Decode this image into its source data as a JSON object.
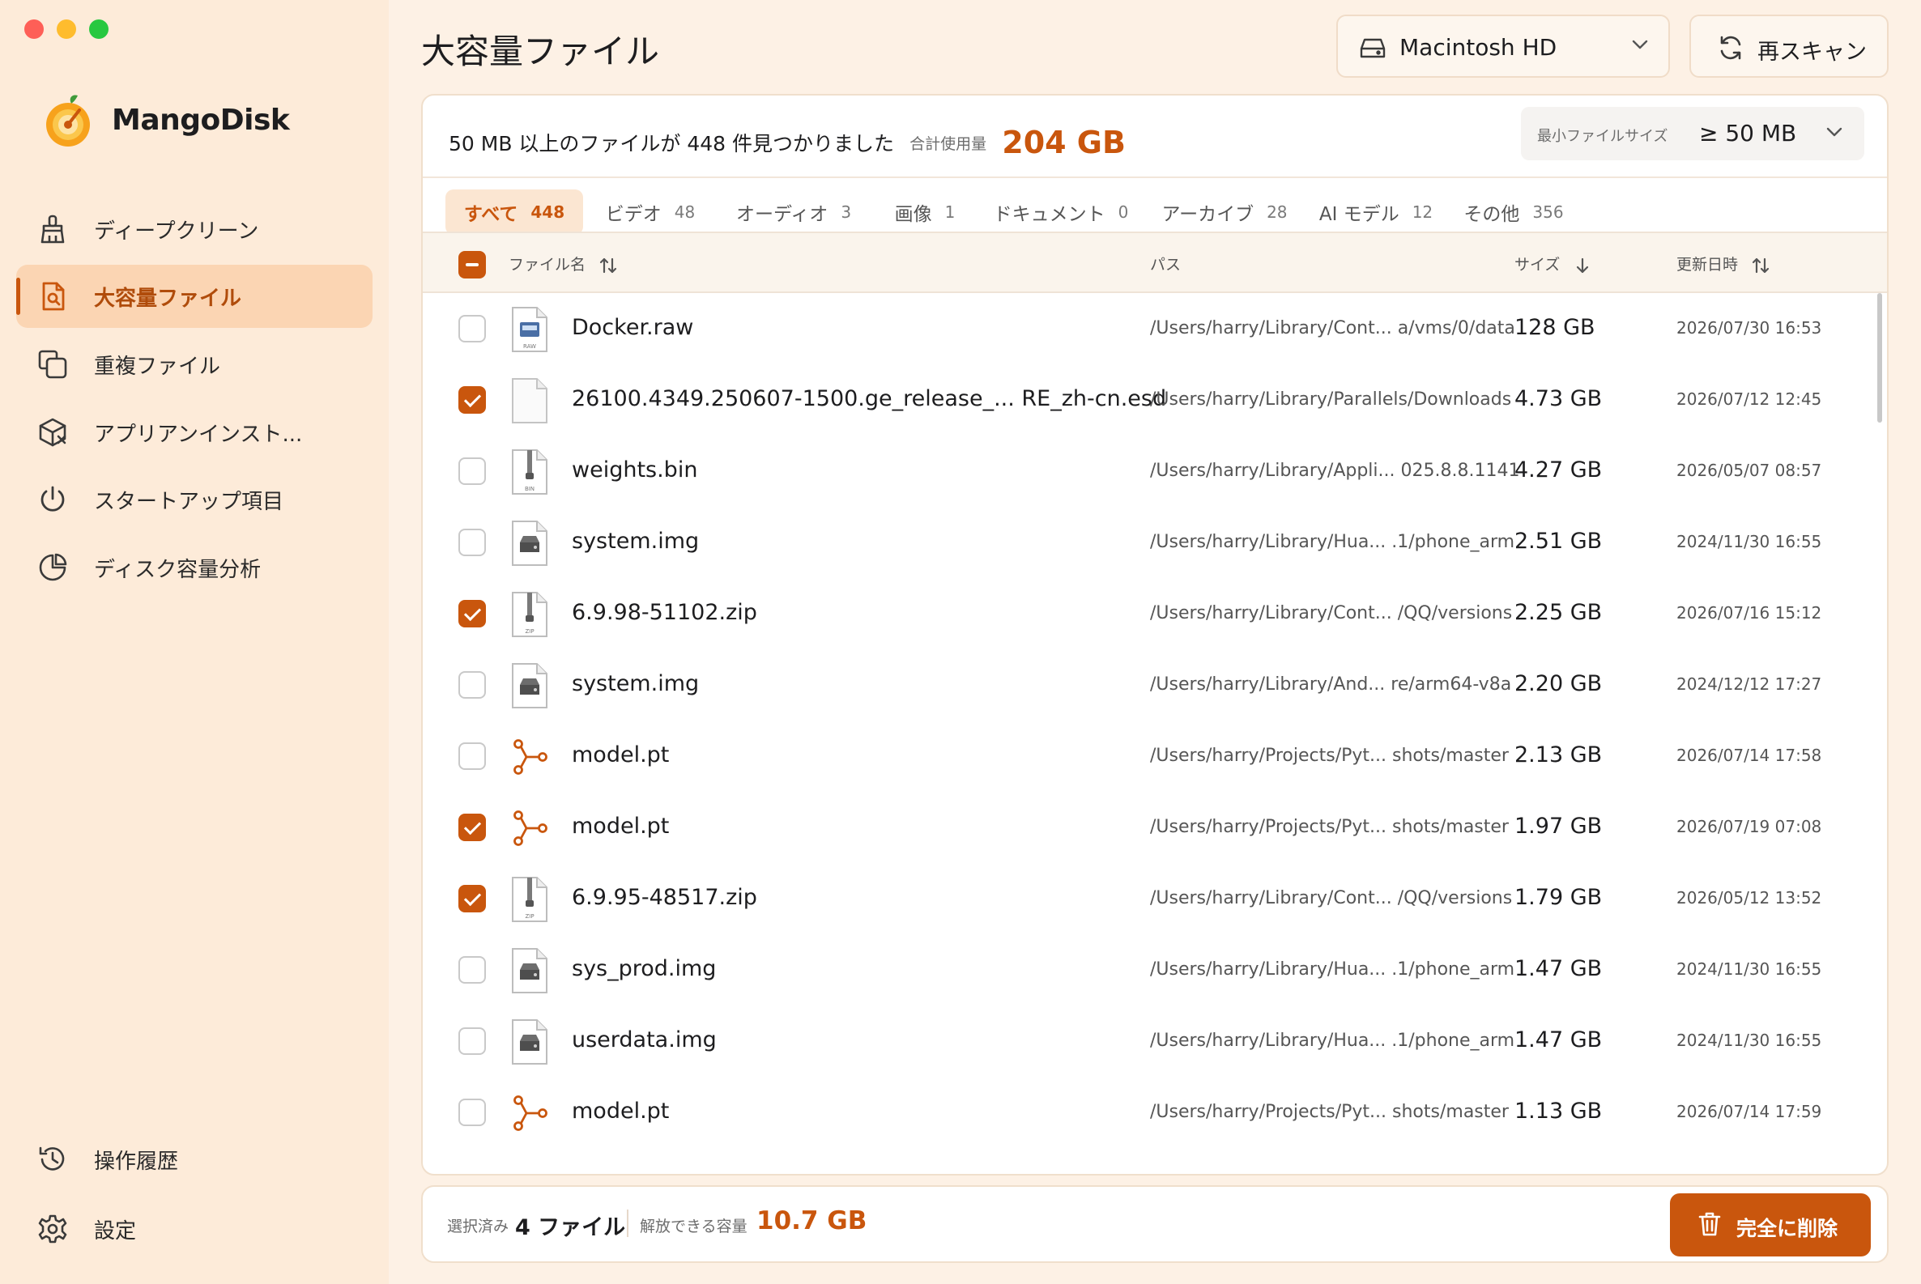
{
  "app": {
    "name": "MangoDisk"
  },
  "sidebar": {
    "items": [
      {
        "label": "ディープクリーン",
        "icon": "broom-icon"
      },
      {
        "label": "大容量ファイル",
        "icon": "document-search-icon",
        "active": true
      },
      {
        "label": "重複ファイル",
        "icon": "duplicate-icon"
      },
      {
        "label": "アプリアンインスト...",
        "icon": "package-remove-icon"
      },
      {
        "label": "スタートアップ項目",
        "icon": "power-icon"
      },
      {
        "label": "ディスク容量分析",
        "icon": "pie-chart-icon"
      }
    ],
    "bottom": [
      {
        "label": "操作履歴",
        "icon": "history-icon"
      },
      {
        "label": "設定",
        "icon": "gear-icon"
      }
    ]
  },
  "header": {
    "title": "大容量ファイル",
    "disk": "Macintosh HD",
    "rescan": "再スキャン"
  },
  "summary": {
    "text": "50 MB 以上のファイルが 448 件見つかりました",
    "total_label": "合計使用量",
    "total_value": "204 GB",
    "min_size_label": "最小ファイルサイズ",
    "min_size_value": "≥ 50 MB"
  },
  "tabs": [
    {
      "label": "すべて",
      "count": "448",
      "active": true
    },
    {
      "label": "ビデオ",
      "count": "48"
    },
    {
      "label": "オーディオ",
      "count": "3"
    },
    {
      "label": "画像",
      "count": "1"
    },
    {
      "label": "ドキュメント",
      "count": "0"
    },
    {
      "label": "アーカイブ",
      "count": "28"
    },
    {
      "label": "AI モデル",
      "count": "12"
    },
    {
      "label": "その他",
      "count": "356"
    }
  ],
  "table": {
    "columns": {
      "name": "ファイル名",
      "path": "パス",
      "size": "サイズ",
      "date": "更新日時"
    },
    "rows": [
      {
        "checked": false,
        "icon": "raw-file-icon",
        "name": "Docker.raw",
        "path": "/Users/harry/Library/Cont... a/vms/0/data",
        "size": "128 GB",
        "date": "2026/07/30 16:53"
      },
      {
        "checked": true,
        "icon": "blank-file-icon",
        "name": "26100.4349.250607-1500.ge_release_... RE_zh-cn.esd",
        "path": "/Users/harry/Library/Parallels/Downloads",
        "size": "4.73 GB",
        "date": "2026/07/12 12:45"
      },
      {
        "checked": false,
        "icon": "bin-file-icon",
        "name": "weights.bin",
        "path": "/Users/harry/Library/Appli... 025.8.8.1141",
        "size": "4.27 GB",
        "date": "2026/05/07 08:57"
      },
      {
        "checked": false,
        "icon": "disk-image-icon",
        "name": "system.img",
        "path": "/Users/harry/Library/Hua... .1/phone_arm",
        "size": "2.51 GB",
        "date": "2024/11/30 16:55"
      },
      {
        "checked": true,
        "icon": "zip-file-icon",
        "name": "6.9.98-51102.zip",
        "path": "/Users/harry/Library/Cont... /QQ/versions",
        "size": "2.25 GB",
        "date": "2026/07/16 15:12"
      },
      {
        "checked": false,
        "icon": "disk-image-icon",
        "name": "system.img",
        "path": "/Users/harry/Library/And... re/arm64-v8a",
        "size": "2.20 GB",
        "date": "2024/12/12 17:27"
      },
      {
        "checked": false,
        "icon": "model-graph-icon",
        "name": "model.pt",
        "path": "/Users/harry/Projects/Pyt... shots/master",
        "size": "2.13 GB",
        "date": "2026/07/14 17:58"
      },
      {
        "checked": true,
        "icon": "model-graph-icon",
        "name": "model.pt",
        "path": "/Users/harry/Projects/Pyt... shots/master",
        "size": "1.97 GB",
        "date": "2026/07/19 07:08"
      },
      {
        "checked": true,
        "icon": "zip-file-icon",
        "name": "6.9.95-48517.zip",
        "path": "/Users/harry/Library/Cont... /QQ/versions",
        "size": "1.79 GB",
        "date": "2026/05/12 13:52"
      },
      {
        "checked": false,
        "icon": "disk-image-icon",
        "name": "sys_prod.img",
        "path": "/Users/harry/Library/Hua... .1/phone_arm",
        "size": "1.47 GB",
        "date": "2024/11/30 16:55"
      },
      {
        "checked": false,
        "icon": "disk-image-icon",
        "name": "userdata.img",
        "path": "/Users/harry/Library/Hua... .1/phone_arm",
        "size": "1.47 GB",
        "date": "2024/11/30 16:55"
      },
      {
        "checked": false,
        "icon": "model-graph-icon",
        "name": "model.pt",
        "path": "/Users/harry/Projects/Pyt... shots/master",
        "size": "1.13 GB",
        "date": "2026/07/14 17:59"
      }
    ]
  },
  "footer": {
    "selected_label": "選択済み",
    "selected_count": "4 ファイル",
    "free_label": "解放できる容量",
    "free_value": "10.7 GB",
    "delete": "完全に削除"
  },
  "colors": {
    "accent": "#c9560d",
    "sidebar_bg": "#fdebd9",
    "active_bg": "#fbd5b3",
    "window_bg": "#fdf1e5"
  }
}
